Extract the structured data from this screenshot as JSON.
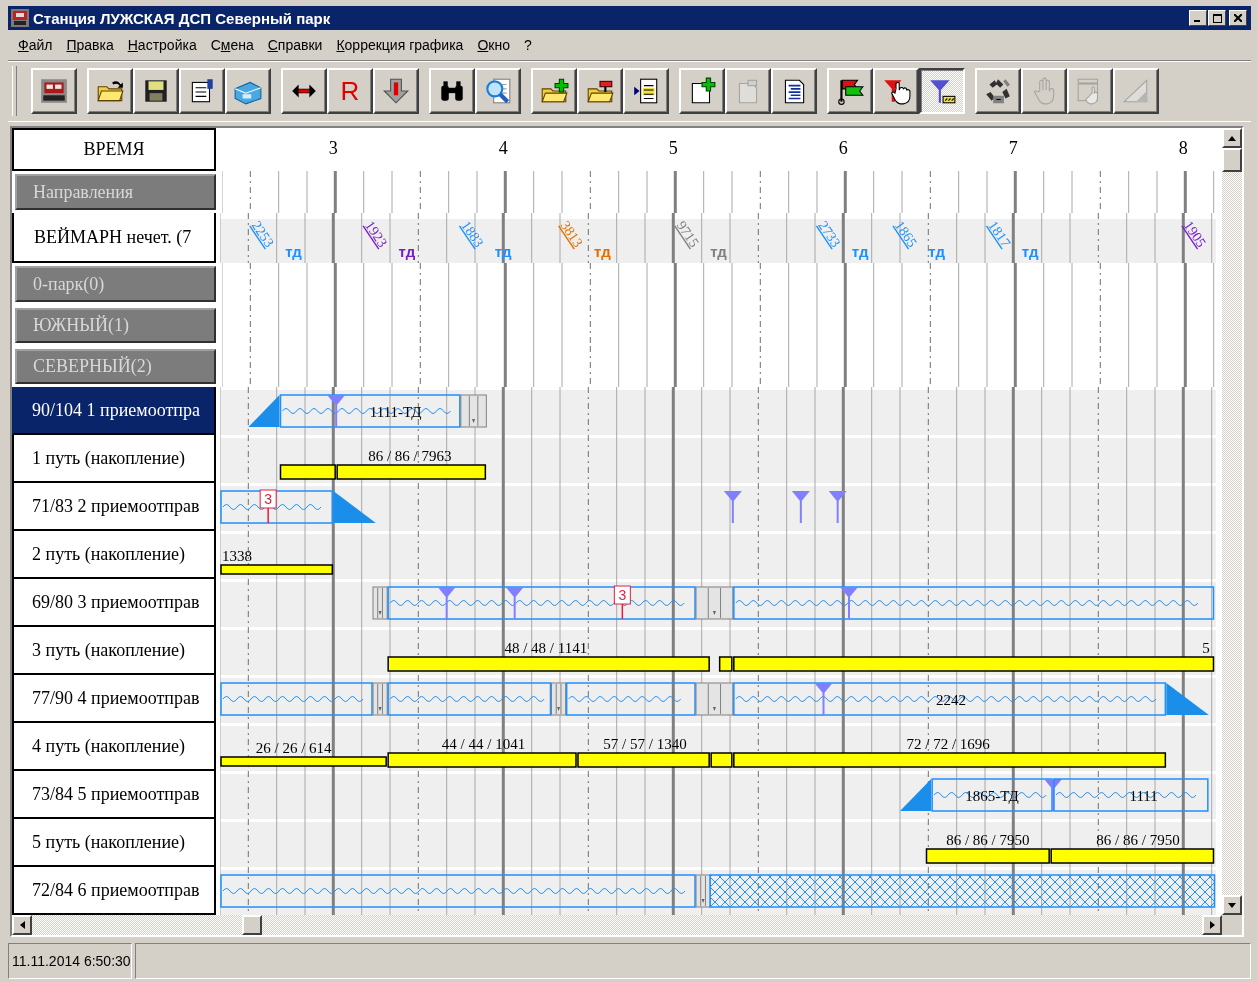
{
  "window": {
    "title": "Станция ЛУЖСКАЯ ДСП Северный парк"
  },
  "menu": [
    {
      "label": "Файл"
    },
    {
      "label": "Правка"
    },
    {
      "label": "Настройка"
    },
    {
      "label": "Смена"
    },
    {
      "label": "Справки"
    },
    {
      "label": "Коррекция графика"
    },
    {
      "label": "Окно"
    },
    {
      "label": "?"
    }
  ],
  "toolbar": {
    "groups": [
      {
        "buttons": [
          {
            "kind": "app",
            "selected": false,
            "disabled": false
          }
        ]
      },
      {
        "buttons": [
          {
            "kind": "open",
            "selected": false,
            "disabled": false
          },
          {
            "kind": "save",
            "selected": false,
            "disabled": false
          },
          {
            "kind": "properties",
            "selected": false,
            "disabled": false
          },
          {
            "kind": "print",
            "selected": false,
            "disabled": false
          }
        ]
      },
      {
        "buttons": [
          {
            "kind": "swap",
            "selected": false,
            "disabled": false
          },
          {
            "kind": "letter",
            "label": "R",
            "selected": false,
            "disabled": false
          },
          {
            "kind": "down",
            "selected": false,
            "disabled": false
          }
        ]
      },
      {
        "buttons": [
          {
            "kind": "binoculars",
            "selected": false,
            "disabled": false
          },
          {
            "kind": "preview",
            "selected": false,
            "disabled": false
          }
        ]
      },
      {
        "buttons": [
          {
            "kind": "folder-add",
            "selected": false,
            "disabled": false
          },
          {
            "kind": "folder-export",
            "selected": false,
            "disabled": false
          },
          {
            "kind": "doc-arrow",
            "selected": false,
            "disabled": false
          }
        ]
      },
      {
        "buttons": [
          {
            "kind": "new-doc",
            "selected": false,
            "disabled": false
          },
          {
            "kind": "blank-doc",
            "selected": false,
            "disabled": true
          },
          {
            "kind": "text-doc",
            "selected": false,
            "disabled": false
          }
        ]
      },
      {
        "buttons": [
          {
            "kind": "flags",
            "selected": false,
            "disabled": false
          },
          {
            "kind": "filter-hand",
            "selected": false,
            "disabled": false
          },
          {
            "kind": "filter",
            "selected": true,
            "disabled": false
          }
        ]
      },
      {
        "buttons": [
          {
            "kind": "recycle",
            "selected": false,
            "disabled": false
          },
          {
            "kind": "hand",
            "selected": false,
            "disabled": true
          },
          {
            "kind": "window-hand",
            "selected": false,
            "disabled": true
          },
          {
            "kind": "triangle",
            "selected": false,
            "disabled": true
          }
        ]
      }
    ]
  },
  "timeline": {
    "header": "ВРЕМЯ",
    "hours": [
      "3",
      "4",
      "5",
      "6",
      "7",
      "8"
    ]
  },
  "rows": [
    {
      "kind": "group",
      "label": "Направления",
      "selected": false
    },
    {
      "kind": "direction",
      "label": "ВЕЙМАРН нечет. (7",
      "selected": false,
      "trains": [
        {
          "number": "2253",
          "suffix": "тд",
          "color": "#1e90ff"
        },
        {
          "number": "1923",
          "suffix": "тд",
          "color": "#7a1fc8"
        },
        {
          "number": "1883",
          "suffix": "тд",
          "color": "#1e90ff"
        },
        {
          "number": "3813",
          "suffix": "тд",
          "color": "#e07000"
        },
        {
          "number": "9715",
          "suffix": "тд",
          "color": "#808080"
        },
        {
          "number": "2733",
          "suffix": "тд",
          "color": "#1e90ff"
        },
        {
          "number": "1865",
          "suffix": "тд",
          "color": "#1e90ff"
        },
        {
          "number": "1817",
          "suffix": "тд",
          "color": "#1e90ff"
        },
        {
          "number": "1905",
          "color": "#7a1fc8"
        }
      ]
    },
    {
      "kind": "group",
      "label": "0-парк(0)",
      "selected": false
    },
    {
      "kind": "group",
      "label": "ЮЖНЫЙ(1)",
      "selected": false
    },
    {
      "kind": "group",
      "label": "СЕВЕРНЫЙ(2)",
      "selected": false
    },
    {
      "kind": "track",
      "label": "90/104 1 приемоотпра",
      "selected": true,
      "items": [
        {
          "kind": "ramp-up"
        },
        {
          "kind": "train",
          "label": "1111-ТД"
        },
        {
          "kind": "marker"
        },
        {
          "kind": "block"
        }
      ]
    },
    {
      "kind": "track",
      "label": "1 путь (накопление)",
      "selected": false,
      "items": [
        {
          "kind": "bar"
        },
        {
          "kind": "bar",
          "label": "86 / 86 / 7963"
        }
      ]
    },
    {
      "kind": "track",
      "label": "71/83 2 приемоотправ",
      "selected": false,
      "items": [
        {
          "kind": "train"
        },
        {
          "kind": "flag",
          "label": "3"
        },
        {
          "kind": "ramp-down"
        },
        {
          "kind": "marker"
        },
        {
          "kind": "marker"
        },
        {
          "kind": "marker"
        }
      ]
    },
    {
      "kind": "track",
      "label": "2 путь (накопление)",
      "selected": false,
      "items": [
        {
          "kind": "thin-bar",
          "label": "1338"
        }
      ]
    },
    {
      "kind": "track",
      "label": "69/80 3 приемоотправ",
      "selected": false,
      "items": [
        {
          "kind": "block"
        },
        {
          "kind": "train"
        },
        {
          "kind": "marker"
        },
        {
          "kind": "marker"
        },
        {
          "kind": "flag",
          "label": "3"
        },
        {
          "kind": "block"
        },
        {
          "kind": "train"
        },
        {
          "kind": "marker"
        }
      ]
    },
    {
      "kind": "track",
      "label": "3 путь (накопление)",
      "selected": false,
      "items": [
        {
          "kind": "bar",
          "label": "48 / 48 / 1141"
        },
        {
          "kind": "bar"
        },
        {
          "kind": "bar",
          "label": "5"
        }
      ]
    },
    {
      "kind": "track",
      "label": "77/90 4 приемоотправ",
      "selected": false,
      "items": [
        {
          "kind": "train"
        },
        {
          "kind": "block"
        },
        {
          "kind": "train"
        },
        {
          "kind": "block"
        },
        {
          "kind": "train"
        },
        {
          "kind": "block"
        },
        {
          "kind": "train",
          "label": "2242"
        },
        {
          "kind": "marker"
        },
        {
          "kind": "ramp-down"
        }
      ]
    },
    {
      "kind": "track",
      "label": "4 путь (накопление)",
      "selected": false,
      "items": [
        {
          "kind": "thin-bar",
          "label": "26 / 26 / 614"
        },
        {
          "kind": "bar",
          "label": "44 / 44 / 1041"
        },
        {
          "kind": "bar",
          "label": "57 / 57 / 1340"
        },
        {
          "kind": "bar"
        },
        {
          "kind": "bar",
          "label": "72 / 72 / 1696"
        }
      ]
    },
    {
      "kind": "track",
      "label": "73/84 5 приемоотправ",
      "selected": false,
      "items": [
        {
          "kind": "ramp-up"
        },
        {
          "kind": "train",
          "label": "1865-ТД"
        },
        {
          "kind": "marker"
        },
        {
          "kind": "train",
          "label": "1111"
        }
      ]
    },
    {
      "kind": "track",
      "label": "5 путь (накопление)",
      "selected": false,
      "items": [
        {
          "kind": "bar",
          "label": "86 / 86 / 7950"
        },
        {
          "kind": "bar",
          "label": "86 / 86 / 7950"
        }
      ]
    },
    {
      "kind": "track",
      "label": "72/84 6 приемоотправ",
      "selected": false,
      "items": [
        {
          "kind": "train"
        },
        {
          "kind": "block"
        },
        {
          "kind": "hatched"
        }
      ]
    }
  ],
  "status_bar": [
    "11.11.2014 6:50:30"
  ]
}
